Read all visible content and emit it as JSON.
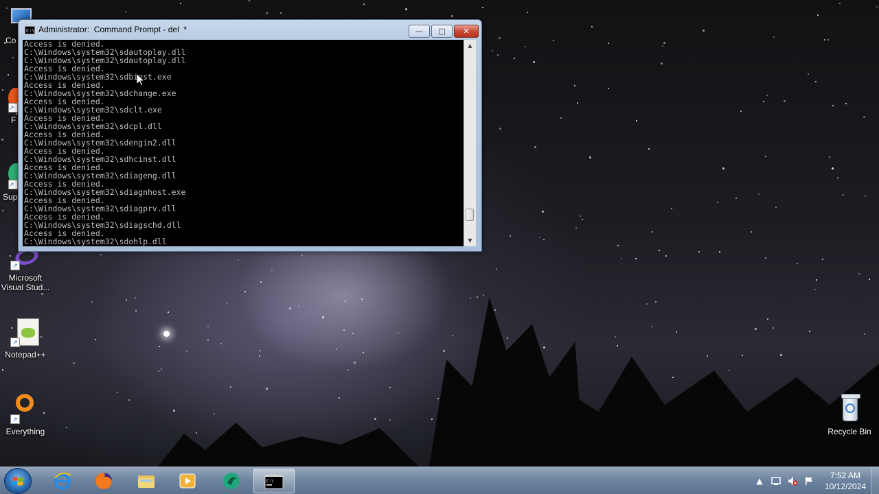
{
  "desktop": {
    "icons": [
      {
        "label": "Co"
      },
      {
        "label": "F"
      },
      {
        "label": "Sup"
      },
      {
        "label": "Microsoft Visual Stud..."
      },
      {
        "label": "Notepad++"
      },
      {
        "label": "Everything"
      },
      {
        "label": "Recycle Bin"
      }
    ]
  },
  "window": {
    "title": "Administrator:  Command Prompt - del  *",
    "icon_text": "C:\\",
    "buttons": {
      "minimize": "—",
      "maximize": "□",
      "close": "✕"
    },
    "console_lines": [
      "Access is denied.",
      "C:\\Windows\\system32\\sdautoplay.dll",
      "C:\\Windows\\system32\\sdautoplay.dll",
      "Access is denied.",
      "C:\\Windows\\system32\\sdbinst.exe",
      "Access is denied.",
      "C:\\Windows\\system32\\sdchange.exe",
      "Access is denied.",
      "C:\\Windows\\system32\\sdclt.exe",
      "Access is denied.",
      "C:\\Windows\\system32\\sdcpl.dll",
      "Access is denied.",
      "C:\\Windows\\system32\\sdengin2.dll",
      "Access is denied.",
      "C:\\Windows\\system32\\sdhcinst.dll",
      "Access is denied.",
      "C:\\Windows\\system32\\sdiageng.dll",
      "Access is denied.",
      "C:\\Windows\\system32\\sdiagnhost.exe",
      "Access is denied.",
      "C:\\Windows\\system32\\sdiagprv.dll",
      "Access is denied.",
      "C:\\Windows\\system32\\sdiagschd.dll",
      "Access is denied.",
      "C:\\Windows\\system32\\sdohlp.dll"
    ],
    "scroll_position": 0.92
  },
  "taskbar": {
    "pinned": [
      {
        "name": "internet-explorer",
        "icon": "ie-icon"
      },
      {
        "name": "firefox",
        "icon": "firefox-icon"
      },
      {
        "name": "file-explorer",
        "icon": "folder-icon"
      },
      {
        "name": "media-player",
        "icon": "media-player-icon"
      },
      {
        "name": "app",
        "icon": "app-icon"
      },
      {
        "name": "command-prompt",
        "icon": "cmd-icon",
        "active": true
      }
    ],
    "tray": {
      "expand": "▲"
    },
    "clock": {
      "time": "7:52 AM",
      "date": "10/12/2024"
    }
  },
  "colors": {
    "console_bg": "#000000",
    "console_fg": "#c0c0c0",
    "close_button": "#c74a36"
  }
}
